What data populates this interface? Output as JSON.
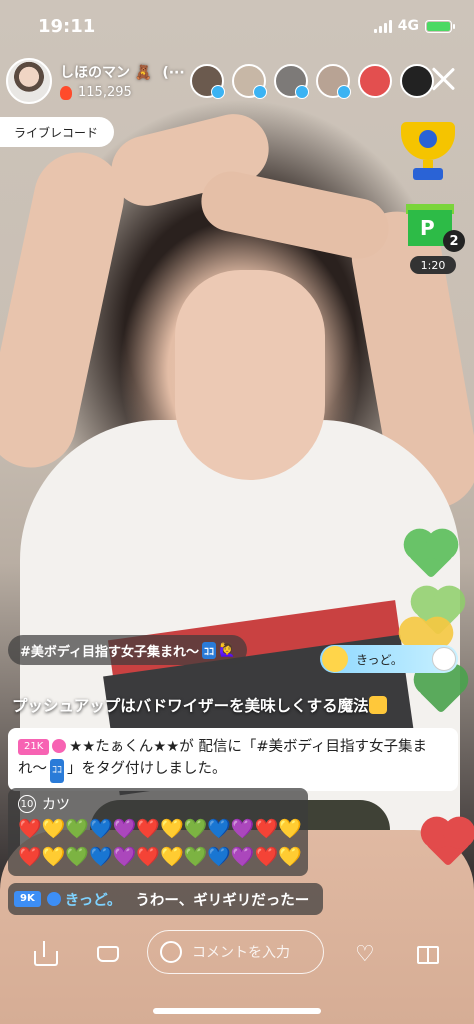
{
  "status": {
    "time": "19:11",
    "network": "4G"
  },
  "host": {
    "name": "しほのマン 🧸",
    "more": "(···",
    "points": "115,295"
  },
  "viewers": [
    {
      "color": "#6b5a4e"
    },
    {
      "color": "#c7b7a6"
    },
    {
      "color": "#7d7a78"
    },
    {
      "color": "#b8a394"
    },
    {
      "color": "#e34f4f"
    },
    {
      "color": "#222222"
    }
  ],
  "live_record_label": "ライブレコード",
  "gift_widget": {
    "count": "2",
    "timer": "1:20"
  },
  "hashtag": {
    "text": "#美ボディ目指す女子集まれ〜",
    "coco": "ｺｺ",
    "emoji": "🙋‍♀️"
  },
  "join": {
    "name": "きっど。"
  },
  "headline": "プッシュアップはバドワイザーを美味しくする魔法",
  "announcement": {
    "badge": "21K",
    "text": "★★たぁくん★★が 配信に「#美ボディ目指す女子集まれ〜",
    "coco": "ｺｺ",
    "tail": "」をタグ付けしました。"
  },
  "hearts_comment": {
    "rank": "10",
    "name": "カツ",
    "row1": "❤️💛💚💙💜❤️💛💚💙💜❤️💛",
    "row2": "❤️💛💚💙💜❤️💛💚💙💜❤️💛"
  },
  "chat": {
    "badge": "9K",
    "user": "きっど。",
    "message": "うわー、ギリギリだったー"
  },
  "toolbar": {
    "comment_placeholder": "コメントを入力",
    "like_icon": "♡"
  }
}
